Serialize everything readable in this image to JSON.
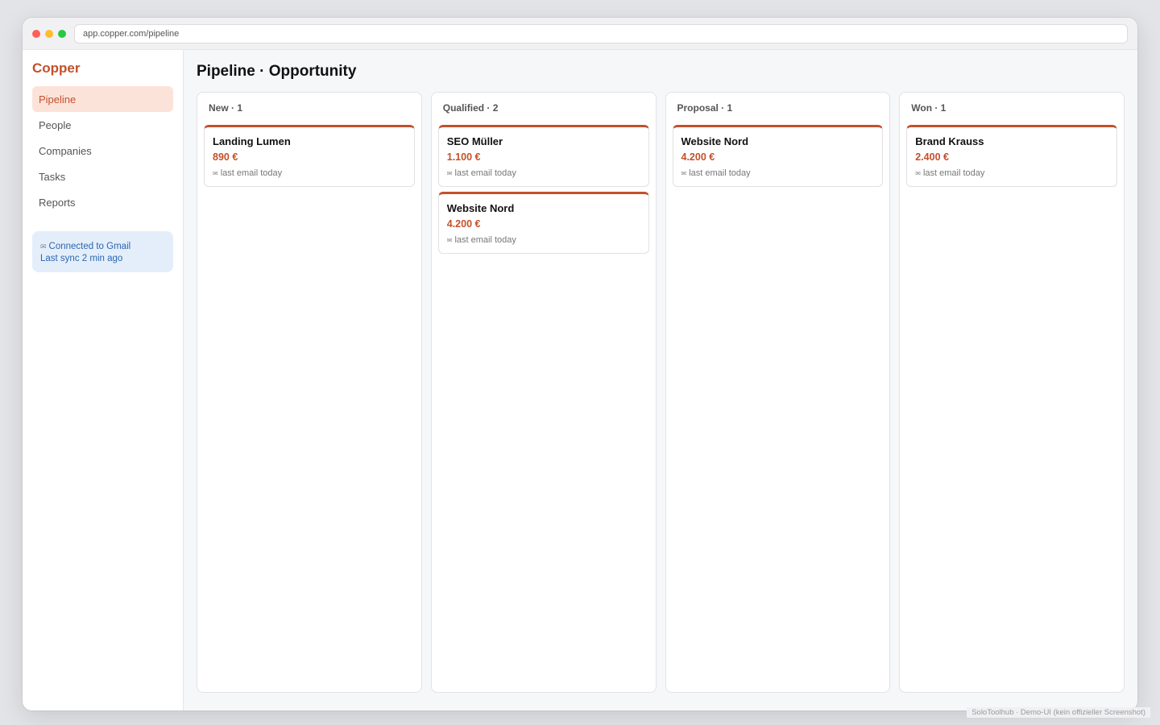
{
  "browser": {
    "url": "app.copper.com/pipeline"
  },
  "sidebar": {
    "brand": "Copper",
    "items": [
      {
        "label": "Pipeline",
        "active": true
      },
      {
        "label": "People",
        "active": false
      },
      {
        "label": "Companies",
        "active": false
      },
      {
        "label": "Tasks",
        "active": false
      },
      {
        "label": "Reports",
        "active": false
      }
    ],
    "gmail": {
      "icon": "mail-icon",
      "line1": "Connected to Gmail",
      "line2": "Last sync 2 min ago"
    }
  },
  "main": {
    "title": "Pipeline · Opportunity",
    "columns": [
      {
        "header": "New · 1",
        "cards": [
          {
            "title": "Landing Lumen",
            "amount": "890 €",
            "meta": "last email today"
          }
        ]
      },
      {
        "header": "Qualified · 2",
        "cards": [
          {
            "title": "SEO Müller",
            "amount": "1.100 €",
            "meta": "last email today"
          },
          {
            "title": "Website Nord",
            "amount": "4.200 €",
            "meta": "last email today"
          }
        ]
      },
      {
        "header": "Proposal · 1",
        "cards": [
          {
            "title": "Website Nord",
            "amount": "4.200 €",
            "meta": "last email today"
          }
        ]
      },
      {
        "header": "Won · 1",
        "cards": [
          {
            "title": "Brand Krauss",
            "amount": "2.400 €",
            "meta": "last email today"
          }
        ]
      }
    ]
  },
  "footer": {
    "note": "SoloToolhub · Demo-UI (kein offizieller Screenshot)"
  },
  "colors": {
    "accent": "#c4502a",
    "active_bg": "#fce3da",
    "info_bg": "#e4eefa",
    "info_text": "#2a66b0"
  }
}
